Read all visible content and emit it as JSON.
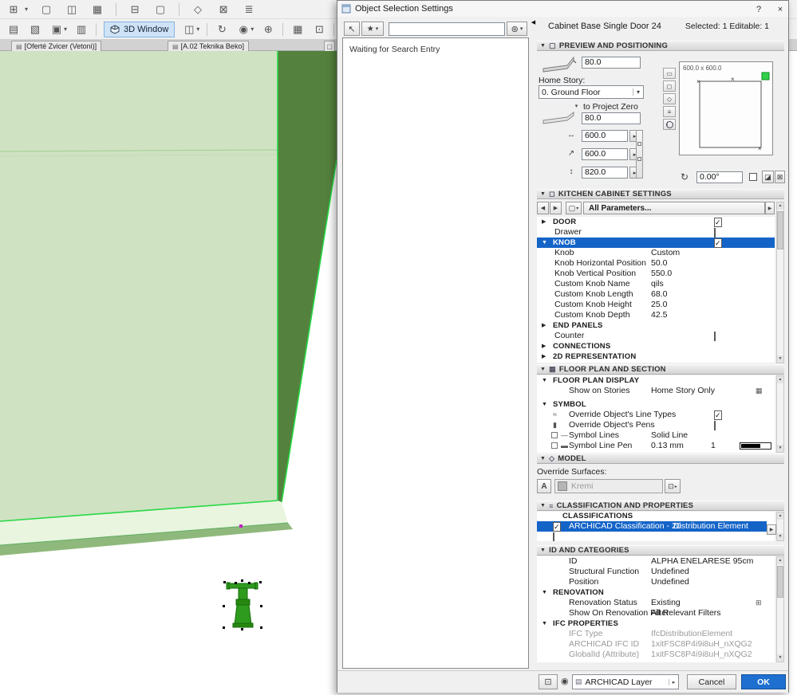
{
  "titlebar": {
    "title": "Object Selection Settings",
    "help": "?",
    "close": "×"
  },
  "icons": {
    "check": "✓",
    "tri_down": "▼",
    "tri_right": "▶",
    "tri_left": "◀",
    "caret_down": "▾",
    "spin_right": "▸",
    "up": "▲",
    "down": "▼",
    "star": "★",
    "gear": "⊛",
    "cursor": "↖",
    "collapse_left": "◀",
    "plan_view": "▭",
    "front_view": "◻",
    "axo_view": "◇",
    "list_view": "≡",
    "info": "i",
    "rotate": "↻",
    "width_arrow": "↔",
    "depth_arrow": "↗",
    "height_arrow": "↕",
    "building": "▦",
    "reno_filter": "⊞",
    "mirror": "◪",
    "anchor_box": "⊠",
    "combo_box": "▢",
    "eye": "◉",
    "layer_flyout": "⊡",
    "layer_doc": "▤",
    "surface_pick": "⊡",
    "letter_a": "A",
    "linetype": "≈",
    "pen": "▮",
    "line_sample": "—",
    "pen_sample": "▬",
    "tab_doc": "▤",
    "quick_box": "▢"
  },
  "background": {
    "toolbar_row1_icons": [
      "⊞",
      "▢",
      "◫",
      "▦",
      "⊟",
      "▢",
      "◇",
      "⊠",
      "≣"
    ],
    "toolbar_row2_left": [
      "▤",
      "▧",
      "▣",
      "▥"
    ],
    "row2_3d_window": "3D Window",
    "toolbar_row2_right": [
      "◫",
      "↻",
      "◉",
      "⊕",
      "▦",
      "⊡",
      "⌂",
      "≡"
    ],
    "tabs": [
      {
        "label": "[Oferté Zvicer (Vetoni)]"
      },
      {
        "label": "[A.02 Teknika Beko]"
      }
    ]
  },
  "search_panel": {
    "status": "Waiting for Search Entry",
    "input_value": ""
  },
  "header": {
    "object_name": "Cabinet Base Single Door 24",
    "selection_info": "Selected: 1 Editable: 1"
  },
  "preview": {
    "section_title": "PREVIEW AND POSITIONING",
    "top_field": "80.0",
    "home_story_label": "Home Story:",
    "home_story_value": "0. Ground Floor",
    "anchor_label": "to Project Zero",
    "elevation_field": "80.0",
    "width_field": "600.0",
    "depth_field": "600.0",
    "height_field": "820.0",
    "preview_size_label": "600.0 x 600.0",
    "angle_field": "0.00°",
    "flip_checked": false
  },
  "params": {
    "section_title": "KITCHEN CABINET SETTINGS",
    "nav_label": "All Parameters...",
    "rows": [
      {
        "label": "DOOR",
        "checked": true
      },
      {
        "label": "Drawer",
        "checked": false
      },
      {
        "label": "KNOB",
        "checked": true
      },
      {
        "label": "Knob",
        "value": "Custom"
      },
      {
        "label": "Knob Horizontal Position",
        "value": "50.0"
      },
      {
        "label": "Knob Vertical Position",
        "value": "550.0"
      },
      {
        "label": "Custom Knob Name",
        "value": "qils"
      },
      {
        "label": "Custom Knob Length",
        "value": "68.0"
      },
      {
        "label": "Custom Knob Height",
        "value": "25.0"
      },
      {
        "label": "Custom Knob Depth",
        "value": "42.5"
      },
      {
        "label": "END PANELS"
      },
      {
        "label": "Counter",
        "checked": false
      },
      {
        "label": "CONNECTIONS"
      },
      {
        "label": "2D REPRESENTATION"
      }
    ]
  },
  "floorplan": {
    "section_title": "FLOOR PLAN AND SECTION",
    "display_header": "FLOOR PLAN DISPLAY",
    "show_on_stories_label": "Show on Stories",
    "show_on_stories_value": "Home Story Only",
    "symbol_header": "SYMBOL",
    "rows": [
      {
        "label": "Override Object's Line Types",
        "checked": true
      },
      {
        "label": "Override Object's Pens",
        "checked": false
      },
      {
        "label": "Symbol Lines",
        "value": "Solid Line"
      },
      {
        "label": "Symbol Line Pen",
        "value": "0.13 mm",
        "pen_number": "1"
      }
    ]
  },
  "model": {
    "section_title": "MODEL",
    "override_surfaces_label": "Override Surfaces:",
    "surface_value": "Kremi"
  },
  "classification": {
    "section_title": "CLASSIFICATION AND PROPERTIES",
    "group_header": "CLASSIFICATIONS",
    "row_label": "ARCHICAD Classification - 20",
    "row_value": "Distribution Element",
    "checked": true
  },
  "id_categories": {
    "section_title": "ID AND CATEGORIES",
    "rows": [
      {
        "label": "ID",
        "value": "ALPHA ENELARESE 95cm"
      },
      {
        "label": "Structural Function",
        "value": "Undefined"
      },
      {
        "label": "Position",
        "value": "Undefined"
      }
    ],
    "renovation_header": "RENOVATION",
    "renovation_rows": [
      {
        "label": "Renovation Status",
        "value": "Existing"
      },
      {
        "label": "Show On Renovation Filter",
        "value": "All Relevant Filters"
      }
    ],
    "ifc_header": "IFC PROPERTIES",
    "ifc_rows": [
      {
        "label": "IFC Type",
        "value": "IfcDistributionElement"
      },
      {
        "label": "ARCHICAD IFC ID",
        "value": "1xitFSC8P4i9i8uH_nXQG2"
      },
      {
        "label": "GlobalId (Attribute)",
        "value": "1xitFSC8P4i9i8uH_nXQG2"
      }
    ]
  },
  "footer": {
    "layer_value": "ARCHICAD Layer",
    "cancel": "Cancel",
    "ok": "OK"
  }
}
